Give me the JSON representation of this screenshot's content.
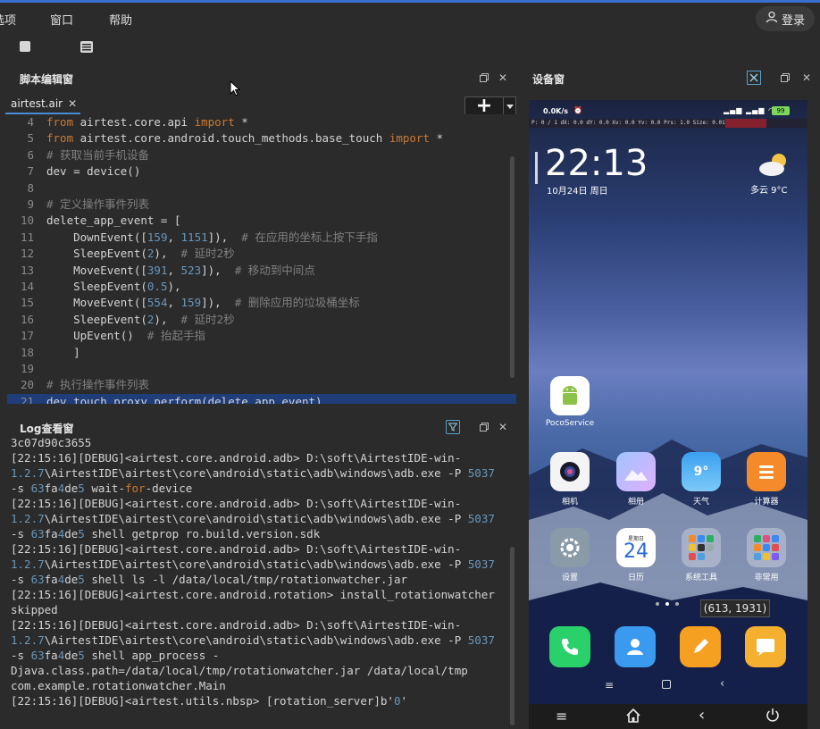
{
  "menubar": {
    "items": [
      "选项",
      "窗口",
      "帮助"
    ],
    "login_label": "登录"
  },
  "toolbar": {
    "icons": [
      "stop-icon",
      "list-icon"
    ]
  },
  "editor_panel": {
    "title": "脚本编辑窗",
    "tab_label": "airtest.air",
    "lines": [
      {
        "n": "4",
        "parts": [
          [
            "kw",
            "from"
          ],
          [
            "t",
            " airtest.core.api "
          ],
          [
            "kw",
            "import"
          ],
          [
            "t",
            " *"
          ]
        ]
      },
      {
        "n": "5",
        "parts": [
          [
            "kw",
            "from"
          ],
          [
            "t",
            " airtest.core.android.touch_methods.base_touch "
          ],
          [
            "kw",
            "import"
          ],
          [
            "t",
            " *"
          ]
        ]
      },
      {
        "n": "6",
        "parts": [
          [
            "cm",
            "# 获取当前手机设备"
          ]
        ]
      },
      {
        "n": "7",
        "parts": [
          [
            "t",
            "dev = device()"
          ]
        ]
      },
      {
        "n": "8",
        "parts": [
          [
            "t",
            ""
          ]
        ]
      },
      {
        "n": "9",
        "parts": [
          [
            "cm",
            "# 定义操作事件列表"
          ]
        ]
      },
      {
        "n": "10",
        "parts": [
          [
            "t",
            "delete_app_event = ["
          ]
        ]
      },
      {
        "n": "11",
        "parts": [
          [
            "t",
            "    DownEvent(["
          ],
          [
            "num",
            "159"
          ],
          [
            "t",
            ", "
          ],
          [
            "num",
            "1151"
          ],
          [
            "t",
            "]),  "
          ],
          [
            "cm",
            "# 在应用的坐标上按下手指"
          ]
        ]
      },
      {
        "n": "12",
        "parts": [
          [
            "t",
            "    SleepEvent("
          ],
          [
            "num",
            "2"
          ],
          [
            "t",
            "),  "
          ],
          [
            "cm",
            "# 延时2秒"
          ]
        ]
      },
      {
        "n": "13",
        "parts": [
          [
            "t",
            "    MoveEvent(["
          ],
          [
            "num",
            "391"
          ],
          [
            "t",
            ", "
          ],
          [
            "num",
            "523"
          ],
          [
            "t",
            "]),  "
          ],
          [
            "cm",
            "# 移动到中间点"
          ]
        ]
      },
      {
        "n": "14",
        "parts": [
          [
            "t",
            "    SleepEvent("
          ],
          [
            "num",
            "0.5"
          ],
          [
            "t",
            "),"
          ]
        ]
      },
      {
        "n": "15",
        "parts": [
          [
            "t",
            "    MoveEvent(["
          ],
          [
            "num",
            "554"
          ],
          [
            "t",
            ", "
          ],
          [
            "num",
            "159"
          ],
          [
            "t",
            "]),  "
          ],
          [
            "cm",
            "# 删除应用的垃圾桶坐标"
          ]
        ]
      },
      {
        "n": "16",
        "parts": [
          [
            "t",
            "    SleepEvent("
          ],
          [
            "num",
            "2"
          ],
          [
            "t",
            "),  "
          ],
          [
            "cm",
            "# 延时2秒"
          ]
        ]
      },
      {
        "n": "17",
        "parts": [
          [
            "t",
            "    UpEvent()  "
          ],
          [
            "cm",
            "# 抬起手指"
          ]
        ]
      },
      {
        "n": "18",
        "parts": [
          [
            "t",
            "    ]"
          ]
        ]
      },
      {
        "n": "19",
        "parts": [
          [
            "t",
            ""
          ]
        ]
      },
      {
        "n": "20",
        "parts": [
          [
            "cm",
            "# 执行操作事件列表"
          ]
        ]
      },
      {
        "n": "21",
        "parts": [
          [
            "t",
            "dev.touch_proxy.perform(delete_app_event)"
          ]
        ],
        "highlight": true
      }
    ]
  },
  "log_panel": {
    "title": "Log查看窗",
    "lines": [
      [
        [
          "t",
          "3c07d90c3655"
        ]
      ],
      [
        [
          "t",
          "[22:15:16][DEBUG]<airtest.core.android.adb> D:\\soft\\AirtestIDE-win-"
        ]
      ],
      [
        [
          "num",
          "1.2.7"
        ],
        [
          "t",
          "\\AirtestIDE\\airtest\\core\\android\\static\\adb\\windows\\adb.exe -P "
        ],
        [
          "num",
          "5037"
        ]
      ],
      [
        [
          "t",
          "-s "
        ],
        [
          "num",
          "63"
        ],
        [
          "t",
          "fa"
        ],
        [
          "num",
          "4"
        ],
        [
          "t",
          "de"
        ],
        [
          "num",
          "5"
        ],
        [
          "t",
          " wait-"
        ],
        [
          "kw",
          "for"
        ],
        [
          "t",
          "-device"
        ]
      ],
      [
        [
          "t",
          "[22:15:16][DEBUG]<airtest.core.android.adb> D:\\soft\\AirtestIDE-win-"
        ]
      ],
      [
        [
          "num",
          "1.2.7"
        ],
        [
          "t",
          "\\AirtestIDE\\airtest\\core\\android\\static\\adb\\windows\\adb.exe -P "
        ],
        [
          "num",
          "5037"
        ]
      ],
      [
        [
          "t",
          "-s "
        ],
        [
          "num",
          "63"
        ],
        [
          "t",
          "fa"
        ],
        [
          "num",
          "4"
        ],
        [
          "t",
          "de"
        ],
        [
          "num",
          "5"
        ],
        [
          "t",
          " shell getprop ro.build.version.sdk"
        ]
      ],
      [
        [
          "t",
          "[22:15:16][DEBUG]<airtest.core.android.adb> D:\\soft\\AirtestIDE-win-"
        ]
      ],
      [
        [
          "num",
          "1.2.7"
        ],
        [
          "t",
          "\\AirtestIDE\\airtest\\core\\android\\static\\adb\\windows\\adb.exe -P "
        ],
        [
          "num",
          "5037"
        ]
      ],
      [
        [
          "t",
          "-s "
        ],
        [
          "num",
          "63"
        ],
        [
          "t",
          "fa"
        ],
        [
          "num",
          "4"
        ],
        [
          "t",
          "de"
        ],
        [
          "num",
          "5"
        ],
        [
          "t",
          " shell ls -l /data/local/tmp/rotationwatcher.jar"
        ]
      ],
      [
        [
          "t",
          "[22:15:16][DEBUG]<airtest.core.android.rotation> install_rotationwatcher"
        ]
      ],
      [
        [
          "t",
          "skipped"
        ]
      ],
      [
        [
          "t",
          "[22:15:16][DEBUG]<airtest.core.android.adb> D:\\soft\\AirtestIDE-win-"
        ]
      ],
      [
        [
          "num",
          "1.2.7"
        ],
        [
          "t",
          "\\AirtestIDE\\airtest\\core\\android\\static\\adb\\windows\\adb.exe -P "
        ],
        [
          "num",
          "5037"
        ]
      ],
      [
        [
          "t",
          "-s "
        ],
        [
          "num",
          "63"
        ],
        [
          "t",
          "fa"
        ],
        [
          "num",
          "4"
        ],
        [
          "t",
          "de"
        ],
        [
          "num",
          "5"
        ],
        [
          "t",
          " shell app_process -"
        ]
      ],
      [
        [
          "t",
          "Djava.class.path=/data/local/tmp/rotationwatcher.jar /data/local/tmp"
        ]
      ],
      [
        [
          "t",
          "com.example.rotationwatcher.Main"
        ]
      ],
      [
        [
          "t",
          "[22:15:16][DEBUG]<airtest.utils.nbsp> [rotation_server]b'"
        ],
        [
          "num",
          "0"
        ],
        [
          "t",
          "'"
        ]
      ]
    ]
  },
  "device_panel": {
    "title": "设备窗",
    "status_speed": "0.0K/s",
    "battery": "99",
    "clock": "22:13",
    "date": "10月24日 周日",
    "weather": "多云  9°C",
    "stat_strip": "P: 0 / 1    dX: 0.0      dY: 0.0      Xv: 0.0      Yv: 0.0      Prs: 1.0     Size: 0.01",
    "apps_row1": [
      {
        "label": "PocoService"
      }
    ],
    "apps_row2": [
      {
        "label": "相机"
      },
      {
        "label": "相册"
      },
      {
        "label": "天气",
        "icon_text": "9°"
      },
      {
        "label": "计算器"
      }
    ],
    "apps_row3": [
      {
        "label": "设置"
      },
      {
        "label": "日历",
        "icon_text": "24",
        "icon_sub": "星期日"
      },
      {
        "label": "系统工具"
      },
      {
        "label": "非常用"
      }
    ],
    "coordinate_tip": "(613, 1931)"
  },
  "colors": {
    "accent": "#3a6fd0",
    "highlight_line": "#1f3d78",
    "keyword": "#cc7832",
    "number": "#6897bb",
    "comment": "#808080"
  }
}
